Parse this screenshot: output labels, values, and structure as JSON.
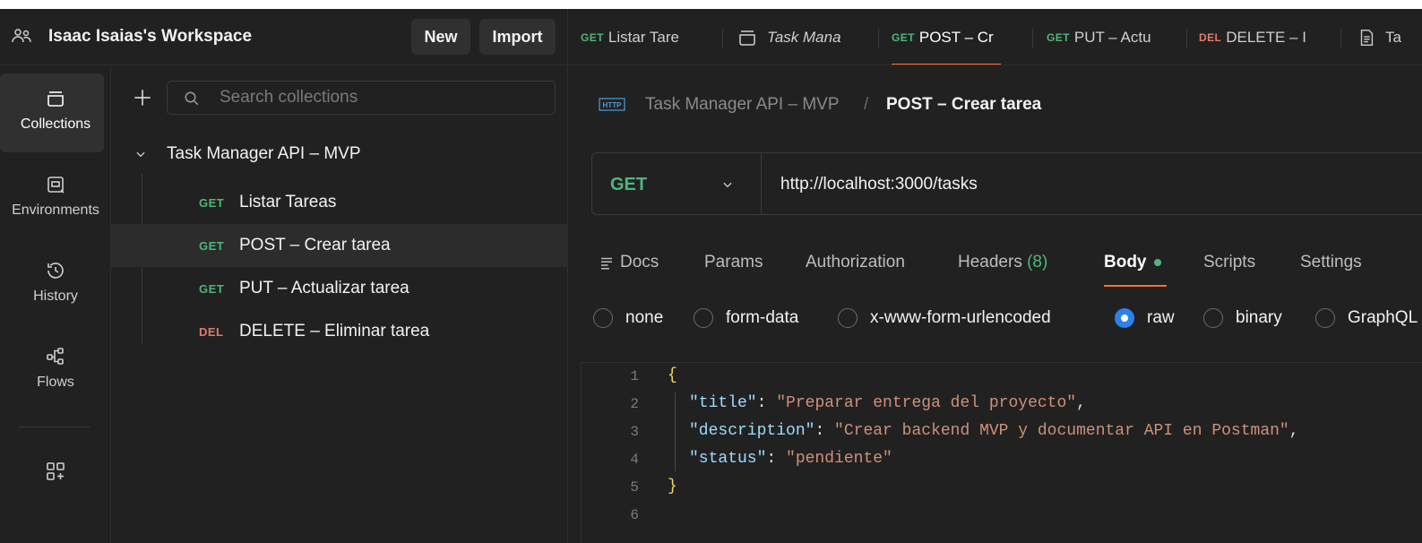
{
  "workspace": {
    "title": "Isaac Isaias's Workspace",
    "new_label": "New",
    "import_label": "Import"
  },
  "rail": {
    "items": [
      {
        "label": "Collections",
        "icon": "collections-icon",
        "active": true
      },
      {
        "label": "Environments",
        "icon": "environments-icon"
      },
      {
        "label": "History",
        "icon": "history-icon"
      },
      {
        "label": "Flows",
        "icon": "flows-icon"
      }
    ]
  },
  "sidebar": {
    "search_placeholder": "Search collections",
    "collection": {
      "name": "Task Manager API – MVP",
      "requests": [
        {
          "method": "GET",
          "name": "Listar Tareas"
        },
        {
          "method": "GET",
          "name": "POST – Crear tarea",
          "selected": true
        },
        {
          "method": "GET",
          "name": "PUT – Actualizar tarea"
        },
        {
          "method": "DEL",
          "name": "DELETE – Eliminar tarea"
        }
      ]
    }
  },
  "tabs": [
    {
      "method": "GET",
      "label": "Listar Tare"
    },
    {
      "method": "",
      "label": "Task Mana",
      "icon": "collection-icon",
      "italic": true
    },
    {
      "method": "GET",
      "label": "POST – Cr",
      "active": true
    },
    {
      "method": "GET",
      "label": "PUT – Actu"
    },
    {
      "method": "DEL",
      "label": "DELETE – I"
    },
    {
      "method": "",
      "label": "Ta",
      "icon": "doc-icon"
    }
  ],
  "breadcrumb": {
    "badge": "HTTP",
    "collection": "Task Manager API – MVP",
    "separator": "/",
    "request": "POST – Crear tarea"
  },
  "request": {
    "method": "GET",
    "url": "http://localhost:3000/tasks"
  },
  "request_tabs": {
    "docs": "Docs",
    "params": "Params",
    "authorization": "Authorization",
    "headers": "Headers",
    "headers_count": "(8)",
    "body": "Body",
    "scripts": "Scripts",
    "settings": "Settings"
  },
  "body_types": {
    "none": "none",
    "form_data": "form-data",
    "urlencoded": "x-www-form-urlencoded",
    "raw": "raw",
    "binary": "binary",
    "graphql": "GraphQL",
    "selected": "raw"
  },
  "editor": {
    "line_numbers": [
      "1",
      "2",
      "3",
      "4",
      "5",
      "6"
    ],
    "open_brace": "{",
    "close_brace": "}",
    "fields": [
      {
        "key": "\"title\"",
        "value": "\"Preparar entrega del proyecto\"",
        "trail": ","
      },
      {
        "key": "\"description\"",
        "value": "\"Crear backend MVP y documentar API en Postman\"",
        "trail": ","
      },
      {
        "key": "\"status\"",
        "value": "\"pendiente\"",
        "trail": ""
      }
    ]
  },
  "colors": {
    "get": "#4fb57c",
    "del": "#e07a6a",
    "accent": "#ff6c37",
    "radio_selected": "#2f80ed"
  }
}
